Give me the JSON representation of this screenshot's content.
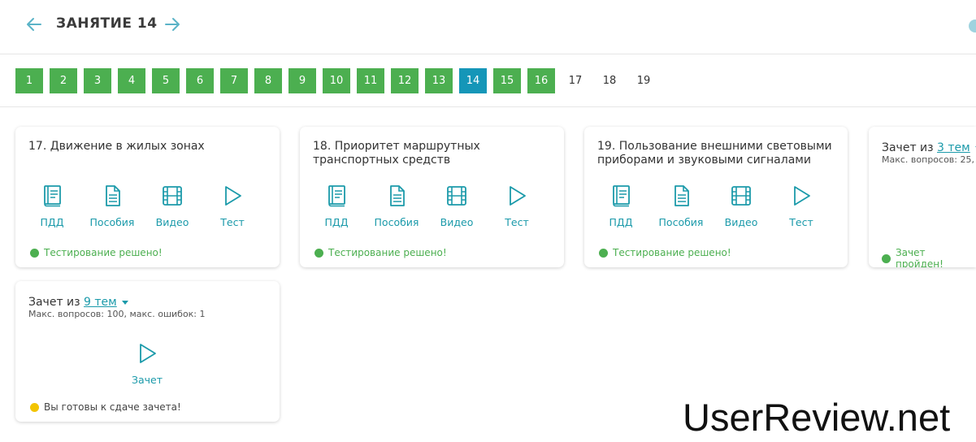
{
  "header": {
    "title": "ЗАНЯТИЕ 14"
  },
  "pager": {
    "pages": [
      {
        "label": "1",
        "state": "done"
      },
      {
        "label": "2",
        "state": "done"
      },
      {
        "label": "3",
        "state": "done"
      },
      {
        "label": "4",
        "state": "done"
      },
      {
        "label": "5",
        "state": "done"
      },
      {
        "label": "6",
        "state": "done"
      },
      {
        "label": "7",
        "state": "done"
      },
      {
        "label": "8",
        "state": "done"
      },
      {
        "label": "9",
        "state": "done"
      },
      {
        "label": "10",
        "state": "done"
      },
      {
        "label": "11",
        "state": "done"
      },
      {
        "label": "12",
        "state": "done"
      },
      {
        "label": "13",
        "state": "done"
      },
      {
        "label": "14",
        "state": "current"
      },
      {
        "label": "15",
        "state": "done"
      },
      {
        "label": "16",
        "state": "done"
      },
      {
        "label": "17",
        "state": "pending"
      },
      {
        "label": "18",
        "state": "pending"
      },
      {
        "label": "19",
        "state": "pending"
      }
    ]
  },
  "actions": {
    "pdd": "ПДД",
    "manuals": "Пособия",
    "video": "Видео",
    "test": "Тест",
    "exam": "Зачет"
  },
  "topics": [
    {
      "title": "17. Движение в жилых зонах",
      "status": "Тестирование решено!"
    },
    {
      "title": "18. Приоритет маршрутных транспортных средств",
      "status": "Тестирование решено!"
    },
    {
      "title": "19. Пользование внешними световыми приборами и звуковыми сигналами",
      "status": "Тестирование решено!"
    }
  ],
  "exam_partial": {
    "prefix": "Зачет из",
    "link": "3 тем",
    "sub": "Макс. вопросов: 25,",
    "status": "Зачет пройден!"
  },
  "exam_full": {
    "prefix": "Зачет из",
    "link": "9 тем",
    "sub": "Макс. вопросов: 100, макс. ошибок: 1",
    "status": "Вы готовы к сдаче зачета!"
  },
  "watermark": "UserReview.net",
  "colors": {
    "done": "#4caf50",
    "current": "#1596b8",
    "accent": "#1b9aaa",
    "warning": "#f2c400"
  },
  "icons": [
    "arrow-left-icon",
    "arrow-right-icon",
    "book-icon",
    "document-icon",
    "film-icon",
    "play-icon"
  ]
}
